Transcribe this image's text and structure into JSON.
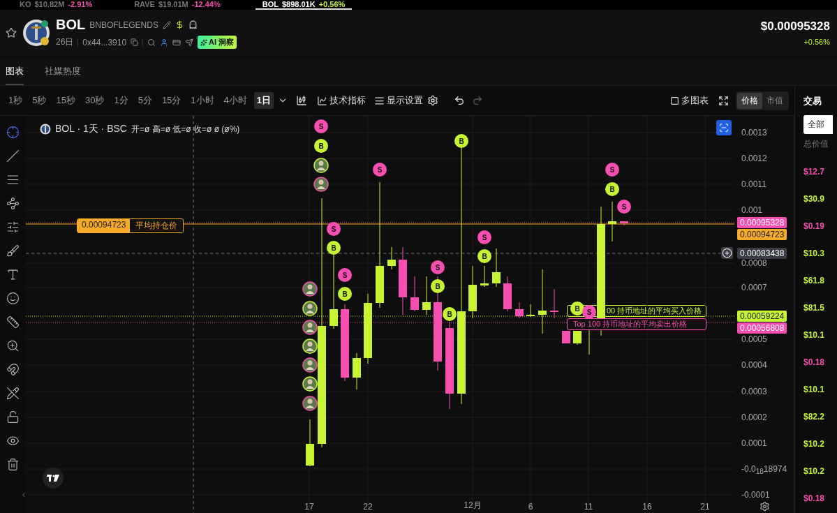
{
  "ticker_tabs": [
    {
      "symbol": "KO",
      "value": "$10.82M",
      "change": "-2.91%",
      "color": "#f74fb1",
      "selected": false
    },
    {
      "symbol": "RAVE",
      "value": "$19.01M",
      "change": "-12.44%",
      "color": "#f74fb1",
      "selected": false
    },
    {
      "symbol": "BOL",
      "value": "$898.01K",
      "change": "+0.56%",
      "color": "#c6f432",
      "selected": true
    }
  ],
  "token": {
    "symbol": "BOL",
    "name": "BNBOFLEGENDS",
    "age": "26日",
    "address": "0x44...3910",
    "ai_badge": "AI 洞察",
    "price": "$0.00095328",
    "change": "+0.56%"
  },
  "tabs": [
    {
      "label": "图表",
      "selected": true
    },
    {
      "label": "社媒热度",
      "selected": false
    }
  ],
  "intervals": [
    {
      "label": "1秒",
      "selected": false
    },
    {
      "label": "5秒",
      "selected": false
    },
    {
      "label": "15秒",
      "selected": false
    },
    {
      "label": "30秒",
      "selected": false
    },
    {
      "label": "1分",
      "selected": false
    },
    {
      "label": "5分",
      "selected": false
    },
    {
      "label": "15分",
      "selected": false
    },
    {
      "label": "1小时",
      "selected": false
    },
    {
      "label": "4小时",
      "selected": false
    },
    {
      "label": "1日",
      "selected": true
    }
  ],
  "toolbar": {
    "indicators": "技术指标",
    "display": "显示设置",
    "multi_chart": "多图表",
    "modes": [
      {
        "label": "价格",
        "selected": true
      },
      {
        "label": "市值",
        "selected": false
      }
    ]
  },
  "chart": {
    "legend_title": "BOL · 1天 · BSC",
    "legend_values": "开=ø 高=ø 低=ø 收=ø ø (ø%)",
    "position_label": {
      "value": "0.00094723",
      "text": "平均持仓价"
    },
    "holder_labels": [
      {
        "kind": "buy",
        "text": "00 持币地址的平均买入价格"
      },
      {
        "kind": "sell",
        "text": "Top 100 持币地址的平均卖出价格"
      }
    ],
    "y_ticks": [
      "0.0013",
      "0.0012",
      "0.0011",
      "0.001",
      "0.0008",
      "0.0007",
      "0.0005",
      "0.0004",
      "0.0003",
      "0.0002",
      "0.0001",
      "-0.0$_{18}$18974",
      "-0.0001"
    ],
    "x_ticks": [
      "17",
      "22",
      "12月",
      "6",
      "11",
      "16",
      "21"
    ],
    "price_tags": [
      {
        "text": "0.00095328",
        "color": "#f74fb1"
      },
      {
        "text": "0.00094723",
        "color": "#f7a928"
      },
      {
        "text": "0.00083438",
        "color": "#3a3d46"
      },
      {
        "text": "0.00059224",
        "color": "#c6f432"
      },
      {
        "text": "0.00056808",
        "color": "#f74fb1"
      }
    ],
    "markers": [
      {
        "kind": "avatar"
      },
      {
        "kind": "avatar"
      },
      {
        "kind": "avatar"
      },
      {
        "kind": "avatar"
      },
      {
        "kind": "avatar"
      },
      {
        "kind": "avatar"
      },
      {
        "kind": "avatar"
      },
      {
        "kind": "sell",
        "label": "S"
      },
      {
        "kind": "buy",
        "label": "B"
      },
      {
        "kind": "avatar"
      },
      {
        "kind": "avatar"
      },
      {
        "kind": "sell",
        "label": "S"
      },
      {
        "kind": "buy",
        "label": "B"
      },
      {
        "kind": "sell",
        "label": "S"
      },
      {
        "kind": "buy",
        "label": "B"
      },
      {
        "kind": "sell",
        "label": "S"
      },
      {
        "kind": "sell",
        "label": "S"
      },
      {
        "kind": "buy",
        "label": "B"
      },
      {
        "kind": "buy",
        "label": "B"
      },
      {
        "kind": "buy",
        "label": "B"
      },
      {
        "kind": "sell",
        "label": "S"
      },
      {
        "kind": "buy",
        "label": "B"
      },
      {
        "kind": "buy",
        "label": "B"
      },
      {
        "kind": "sell",
        "label": "S"
      },
      {
        "kind": "sell",
        "label": "S"
      },
      {
        "kind": "buy",
        "label": "B"
      },
      {
        "kind": "sell",
        "label": "S"
      }
    ]
  },
  "sidebar": {
    "title": "交易",
    "filter": "全部",
    "column": "总价值",
    "values": [
      {
        "text": "$12.7",
        "color": "#f74fb1"
      },
      {
        "text": "$30.9",
        "color": "#c6f432"
      },
      {
        "text": "$0.19",
        "color": "#f74fb1"
      },
      {
        "text": "$10.3",
        "color": "#c6f432"
      },
      {
        "text": "$61.8",
        "color": "#c6f432"
      },
      {
        "text": "$81.5",
        "color": "#c6f432"
      },
      {
        "text": "$10.1",
        "color": "#c6f432"
      },
      {
        "text": "$0.18",
        "color": "#f74fb1"
      },
      {
        "text": "$10.1",
        "color": "#c6f432"
      },
      {
        "text": "$82.2",
        "color": "#c6f432"
      },
      {
        "text": "$10.2",
        "color": "#c6f432"
      },
      {
        "text": "$10.2",
        "color": "#c6f432"
      },
      {
        "text": "$0.18",
        "color": "#f74fb1"
      }
    ]
  }
}
